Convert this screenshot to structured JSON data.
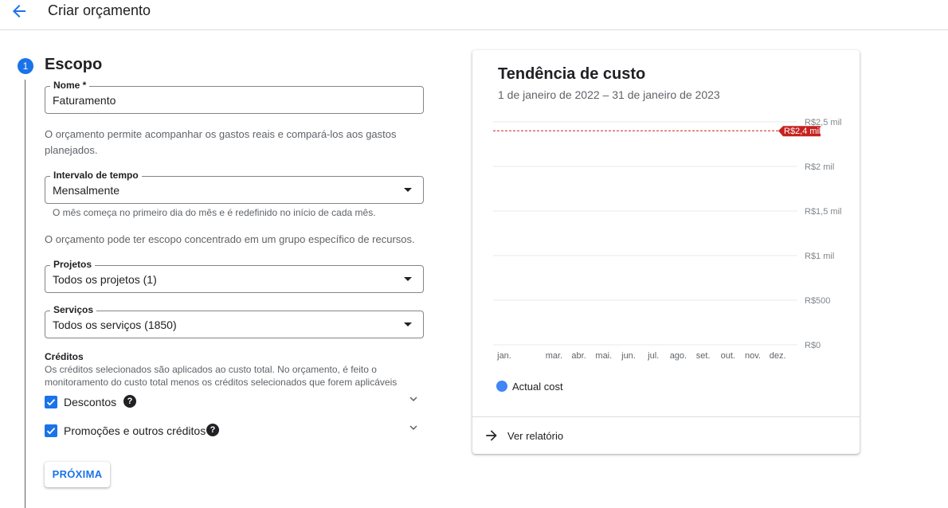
{
  "header": {
    "title": "Criar orçamento"
  },
  "step": {
    "number": "1",
    "title": "Escopo"
  },
  "name_field": {
    "label": "Nome *",
    "value": "Faturamento"
  },
  "budget_description": "O orçamento permite acompanhar os gastos reais e compará-los aos gastos planejados.",
  "interval_field": {
    "label": "Intervalo de tempo",
    "value": "Mensalmente",
    "hint": "O mês começa no primeiro dia do mês e é redefinido no início de cada mês."
  },
  "scope_description": "O orçamento pode ter escopo concentrado em um grupo específico de recursos.",
  "projects_field": {
    "label": "Projetos",
    "value": "Todos os projetos (1)"
  },
  "services_field": {
    "label": "Serviços",
    "value": "Todos os serviços (1850)"
  },
  "credits": {
    "title": "Créditos",
    "description": "Os créditos selecionados são aplicados ao custo total. No orçamento, é feito o monitoramento do custo total menos os créditos selecionados que forem aplicáveis",
    "items": [
      {
        "label": "Descontos",
        "checked": true
      },
      {
        "label": "Promoções e outros créditos",
        "checked": true
      }
    ]
  },
  "next_button": "PRÓXIMA",
  "card": {
    "title": "Tendência de custo",
    "subtitle": "1 de janeiro de 2022 – 31 de janeiro de 2023",
    "report_link": "Ver relatório"
  },
  "colors": {
    "accent": "#1a73e8",
    "series": "#4285f4",
    "budget_line": "#c5221f"
  },
  "chart_data": {
    "type": "line",
    "x": [
      "jan.",
      "mar.",
      "abr.",
      "mai.",
      "jun.",
      "jul.",
      "ago.",
      "set.",
      "out.",
      "nov.",
      "dez."
    ],
    "y_ticks": [
      "R$0",
      "R$500",
      "R$1 mil",
      "R$1,5 mil",
      "R$2 mil",
      "R$2,5 mil"
    ],
    "y_tick_values": [
      0,
      500,
      1000,
      1500,
      2000,
      2500
    ],
    "ylim": [
      0,
      2500
    ],
    "budget": {
      "value": 2400,
      "label": "R$2,4 mil"
    },
    "series": [
      {
        "name": "Actual cost",
        "values": []
      }
    ],
    "grid": true,
    "legend_position": "bottom-left"
  }
}
